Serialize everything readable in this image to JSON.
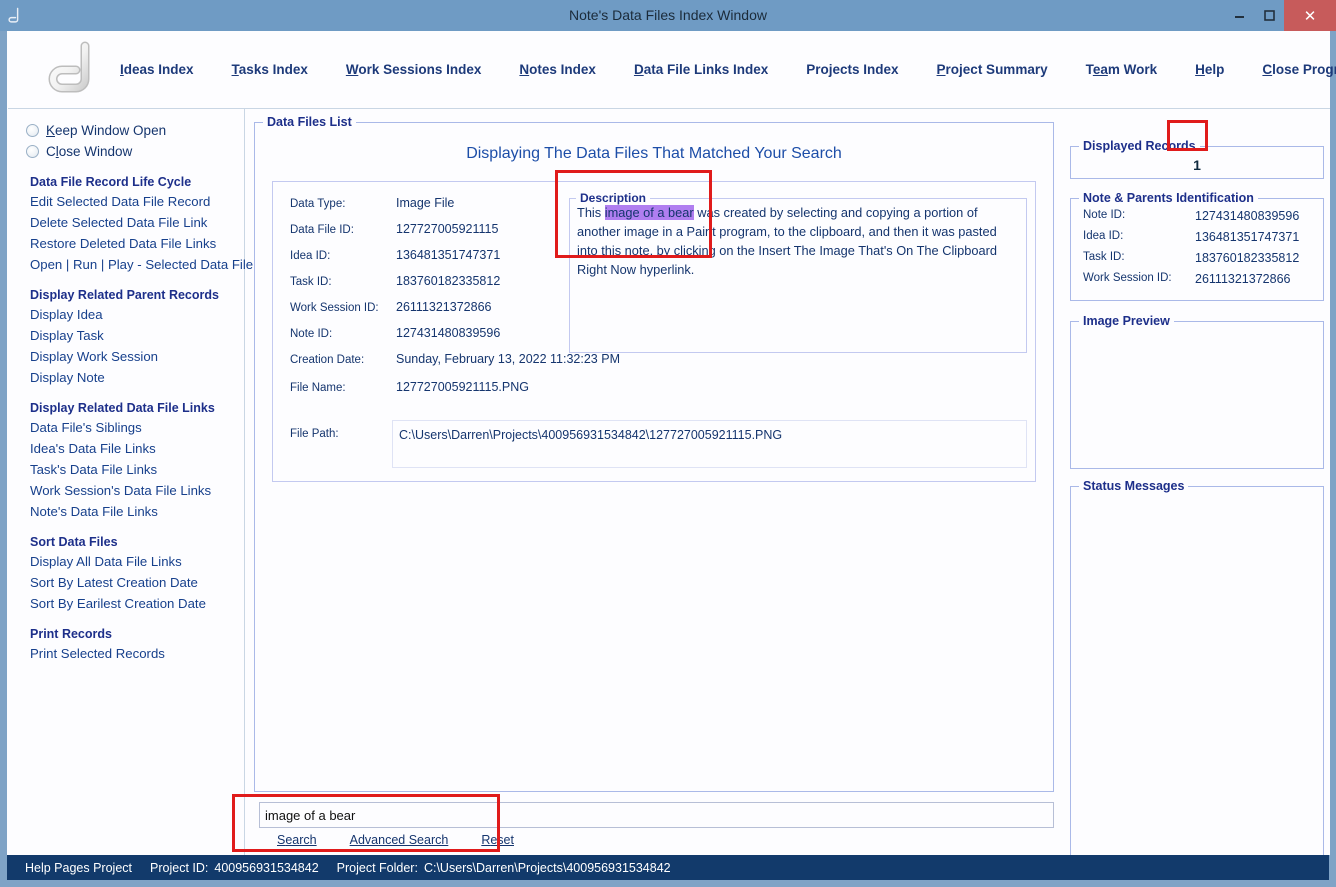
{
  "window": {
    "title": "Note's Data Files Index Window",
    "logo_icon": "app-logo-icon",
    "minimize_label": "–",
    "maximize_label": "❑",
    "close_label": "✕"
  },
  "topnav": {
    "items": [
      {
        "pre": "",
        "acc": "I",
        "post": "deas Index",
        "name": "nav-ideas-index"
      },
      {
        "pre": "",
        "acc": "T",
        "post": "asks Index",
        "name": "nav-tasks-index"
      },
      {
        "pre": "",
        "acc": "W",
        "post": "ork Sessions Index",
        "name": "nav-work-sessions-index"
      },
      {
        "pre": "",
        "acc": "N",
        "post": "otes Index",
        "name": "nav-notes-index"
      },
      {
        "pre": "",
        "acc": "D",
        "post": "ata File Links Index",
        "name": "nav-data-file-links-index"
      },
      {
        "pre": "Projects Index",
        "acc": "",
        "post": "",
        "name": "nav-projects-index"
      },
      {
        "pre": "",
        "acc": "P",
        "post": "roject Summary",
        "name": "nav-project-summary"
      },
      {
        "pre": "T",
        "acc": "ea",
        "post": "m Work",
        "name": "nav-team-work"
      },
      {
        "pre": "",
        "acc": "H",
        "post": "elp",
        "name": "nav-help"
      },
      {
        "pre": "",
        "acc": "C",
        "post": "lose Program",
        "name": "nav-close-program"
      }
    ]
  },
  "sidebar": {
    "radios": [
      {
        "pre": "",
        "acc": "K",
        "post": "eep Window Open",
        "selected": false,
        "name": "radio-keep-window-open"
      },
      {
        "pre": "C",
        "acc": "l",
        "post": "ose Window",
        "selected": false,
        "name": "radio-close-window"
      }
    ],
    "groups": [
      {
        "heading": "Data File Record Life Cycle",
        "items": [
          "Edit Selected Data File Record",
          "Delete Selected Data File Link",
          "Restore Deleted Data File Links",
          "Open | Run | Play - Selected Data File"
        ]
      },
      {
        "heading": "Display Related Parent Records",
        "items": [
          "Display Idea",
          "Display Task",
          "Display Work Session",
          "Display Note"
        ]
      },
      {
        "heading": "Display Related Data File Links",
        "items": [
          "Data File's Siblings",
          "Idea's Data File Links",
          "Task's Data File Links",
          "Work Session's Data File Links",
          "Note's Data File Links"
        ]
      },
      {
        "heading": "Sort Data Files",
        "items": [
          "Display All Data File Links",
          "Sort By Latest Creation Date",
          "Sort By Earilest Creation Date"
        ]
      },
      {
        "heading": "Print Records",
        "items": [
          "Print Selected Records"
        ]
      }
    ]
  },
  "main": {
    "panel_legend": "Data Files List",
    "list_title": "Displaying The Data Files That Matched Your Search",
    "fields": [
      {
        "label": "Data Type:",
        "value": "Image File",
        "name": "field-data-type"
      },
      {
        "label": "Data File ID:",
        "value": "127727005921115",
        "name": "field-data-file-id"
      },
      {
        "label": "Idea ID:",
        "value": "136481351747371",
        "name": "field-idea-id"
      },
      {
        "label": "Task ID:",
        "value": "183760182335812",
        "name": "field-task-id"
      },
      {
        "label": "Work Session ID:",
        "value": "26111321372866",
        "name": "field-work-session-id"
      },
      {
        "label": "Note ID:",
        "value": "127431480839596",
        "name": "field-note-id"
      },
      {
        "label": "Creation Date:",
        "value": "Sunday, February 13, 2022   11:32:23 PM",
        "name": "field-creation-date"
      },
      {
        "label": "File Name:",
        "value": "127727005921115.PNG",
        "name": "field-file-name"
      }
    ],
    "file_path_label": "File Path:",
    "file_path_value": "C:\\Users\\Darren\\Projects\\400956931534842\\127727005921115.PNG",
    "description": {
      "legend": "Description",
      "prefix": "This ",
      "highlight": "image of a bear",
      "suffix": " was created by selecting and copying a portion of another image in a Paint program, to the clipboard, and then it was pasted into this note, by clicking on the Insert The Image That's On The Clipboard Right Now hyperlink.",
      "highlight_color": "#b07ef0"
    }
  },
  "search": {
    "value": "image of a bear",
    "placeholder": "",
    "links": [
      {
        "pre": "",
        "acc": "S",
        "post": "earch",
        "name": "search-link"
      },
      {
        "pre": "",
        "acc": "A",
        "post": "dvanced Search",
        "name": "advanced-search-link"
      },
      {
        "pre": "",
        "acc": "R",
        "post": "eset",
        "name": "reset-link"
      }
    ]
  },
  "right": {
    "displayed_records_legend": "Displayed Records",
    "displayed_records_count": "1",
    "identification_legend": "Note & Parents Identification",
    "identification_rows": [
      {
        "label": "Note ID:",
        "value": "127431480839596",
        "name": "ident-note-id"
      },
      {
        "label": "Idea ID:",
        "value": "136481351747371",
        "name": "ident-idea-id"
      },
      {
        "label": "Task ID:",
        "value": "183760182335812",
        "name": "ident-task-id"
      },
      {
        "label": "Work Session ID:",
        "value": "26111321372866",
        "name": "ident-work-session-id"
      }
    ],
    "image_preview_legend": "Image Preview",
    "status_messages_legend": "Status Messages"
  },
  "statusbar": {
    "project_name": "Help Pages Project",
    "project_id_label": "Project ID:",
    "project_id": "400956931534842",
    "project_folder_label": "Project Folder:",
    "project_folder": "C:\\Users\\Darren\\Projects\\400956931534842"
  },
  "annotations": {
    "highlight_box_color": "#e01b1b"
  }
}
